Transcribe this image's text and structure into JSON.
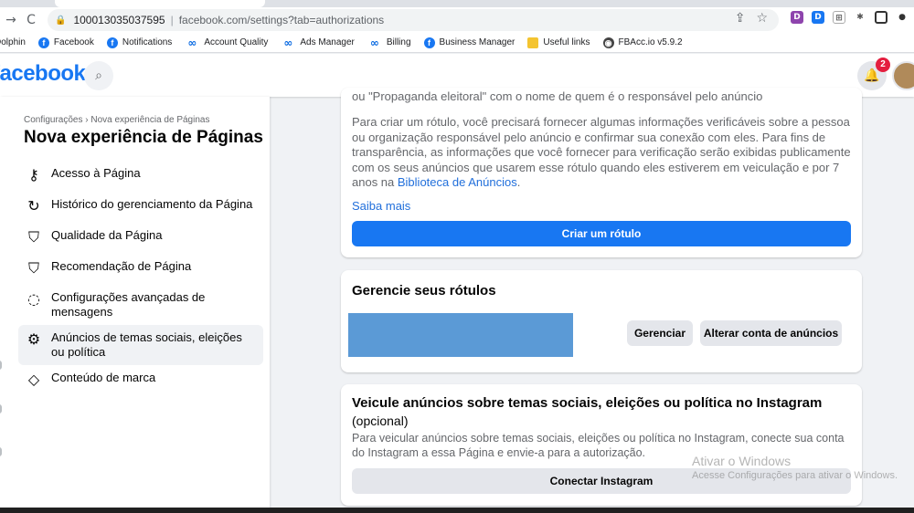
{
  "browser": {
    "url_host": "100013035037595",
    "url_path": "facebook.com/settings?tab=authorizations",
    "nav": {
      "back": "→",
      "reload": "C"
    }
  },
  "bookmarks": [
    {
      "label": "Dolphin",
      "icon": ""
    },
    {
      "label": "Facebook",
      "icon": "fb"
    },
    {
      "label": "Notifications",
      "icon": "fb"
    },
    {
      "label": "Account Quality",
      "icon": "meta"
    },
    {
      "label": "Ads Manager",
      "icon": "meta"
    },
    {
      "label": "Billing",
      "icon": "meta"
    },
    {
      "label": "Business Manager",
      "icon": "fb"
    },
    {
      "label": "Useful links",
      "icon": "folder"
    },
    {
      "label": "FBAcc.io v5.9.2",
      "icon": "fbacc"
    }
  ],
  "fb": {
    "logo": "facebook",
    "notification_count": "2"
  },
  "sidebar": {
    "breadcrumb": "Configurações › Nova experiência de Páginas",
    "title": "Nova experiência de Páginas",
    "items": [
      {
        "label": "Acesso à Página",
        "icon": "key-icon",
        "glyph": "⚷"
      },
      {
        "label": "Histórico do gerenciamento da Página",
        "icon": "history-icon",
        "glyph": "↻"
      },
      {
        "label": "Qualidade da Página",
        "icon": "shield-icon",
        "glyph": "⛉"
      },
      {
        "label": "Recomendação de Página",
        "icon": "shield-user-icon",
        "glyph": "⛉"
      },
      {
        "label": "Configurações avançadas de mensagens",
        "icon": "chat-bubble-icon",
        "glyph": "◌"
      },
      {
        "label": "Anúncios de temas sociais, eleições ou política",
        "icon": "user-gear-icon",
        "glyph": "⚙"
      },
      {
        "label": "Conteúdo de marca",
        "icon": "handshake-icon",
        "glyph": "◇"
      }
    ]
  },
  "card1": {
    "clipped_text": "ou \"Propaganda eleitoral\" com o nome de quem é o responsável pelo anúncio",
    "para_before_link": "Para criar um rótulo, você precisará fornecer algumas informações verificáveis sobre a pessoa ou organização responsável pelo anúncio e confirmar sua conexão com eles. Para fins de transparência, as informações que você fornecer para verificação serão exibidas publicamente com os seus anúncios que usarem esse rótulo quando eles estiverem em veiculação e por 7 anos na ",
    "para_link": "Biblioteca de Anúncios",
    "para_after_link": ".",
    "learn_more": "Saiba mais",
    "create_label_button": "Criar um rótulo"
  },
  "card2": {
    "title": "Gerencie seus rótulos",
    "manage_button": "Gerenciar",
    "change_account_button": "Alterar conta de anúncios"
  },
  "card3": {
    "title": "Veicule anúncios sobre temas sociais, eleições ou política no Instagram",
    "optional": "(opcional)",
    "para": "Para veicular anúncios sobre temas sociais, eleições ou política no Instagram, conecte sua conta do Instagram a essa Página e envie-a para a autorização.",
    "connect_button": "Conectar Instagram"
  },
  "watermark": {
    "line1": "Ativar o Windows",
    "line2": "Acesse Configurações para ativar o Windows."
  },
  "colors": {
    "fb_blue": "#1877f2",
    "link_blue": "#216fdb",
    "redacted_box": "#5b9ad6"
  }
}
